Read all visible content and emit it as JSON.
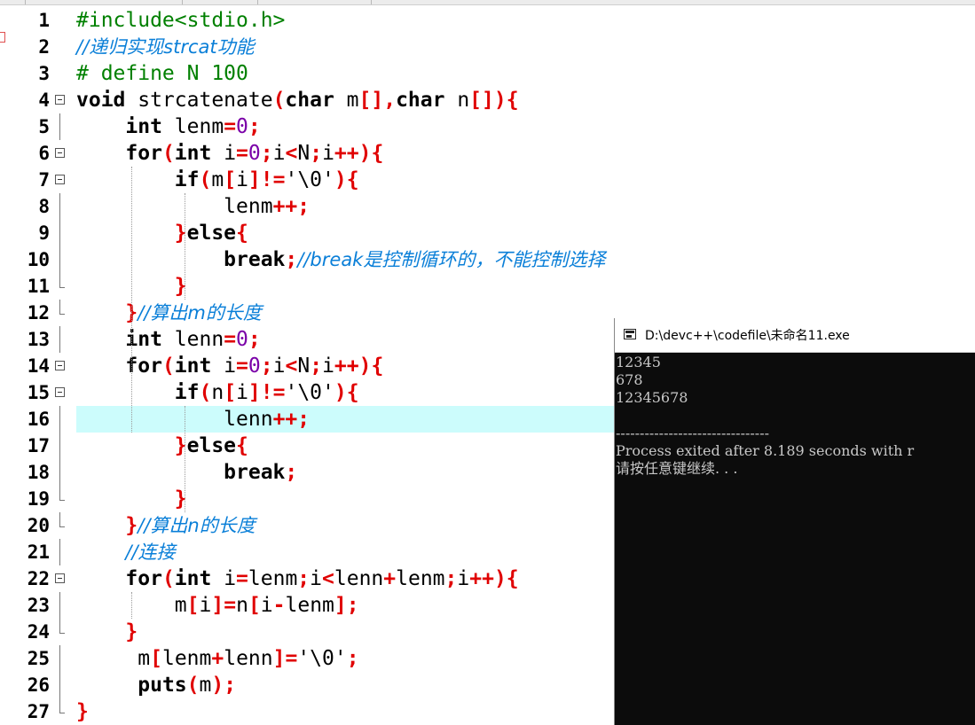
{
  "editor": {
    "line_numbers": [
      "1",
      "2",
      "3",
      "4",
      "5",
      "6",
      "7",
      "8",
      "9",
      "10",
      "11",
      "12",
      "13",
      "14",
      "15",
      "16",
      "17",
      "18",
      "19",
      "20",
      "21",
      "22",
      "23",
      "24",
      "25",
      "26",
      "27"
    ],
    "lines": [
      [
        "#include<stdio.h>"
      ],
      [
        "//递归实现strcat功能"
      ],
      [
        "# define N 100"
      ],
      [
        "void",
        " strcatenate",
        "(",
        "char",
        " m",
        "[]",
        ",",
        "char",
        " n",
        "[]",
        ")",
        "{"
      ],
      [
        "    ",
        "int",
        " lenm",
        "=",
        "0",
        ";"
      ],
      [
        "    ",
        "for",
        "(",
        "int",
        " i",
        "=",
        "0",
        ";",
        "i",
        "<",
        "N",
        ";",
        "i",
        "++",
        ")",
        "{"
      ],
      [
        "        ",
        "if",
        "(",
        "m",
        "[",
        "i",
        "]",
        "!=",
        "'\\0'",
        ")",
        "{"
      ],
      [
        "            ",
        "lenm",
        "++",
        ";"
      ],
      [
        "        ",
        "}",
        "else",
        "{"
      ],
      [
        "            ",
        "break",
        ";",
        "//break是控制循环的，不能控制选择"
      ],
      [
        "        ",
        "}"
      ],
      [
        "    ",
        "}",
        "//算出m的长度"
      ],
      [
        "    ",
        "int",
        " lenn",
        "=",
        "0",
        ";"
      ],
      [
        "    ",
        "for",
        "(",
        "int",
        " i",
        "=",
        "0",
        ";",
        "i",
        "<",
        "N",
        ";",
        "i",
        "++",
        ")",
        "{"
      ],
      [
        "        ",
        "if",
        "(",
        "n",
        "[",
        "i",
        "]",
        "!=",
        "'\\0'",
        ")",
        "{"
      ],
      [
        "            ",
        "lenn",
        "++",
        ";"
      ],
      [
        "        ",
        "}",
        "else",
        "{"
      ],
      [
        "            ",
        "break",
        ";"
      ],
      [
        "        ",
        "}"
      ],
      [
        "    ",
        "}",
        "//算出n的长度"
      ],
      [
        "    ",
        "//连接"
      ],
      [
        "    ",
        "for",
        "(",
        "int",
        " i",
        "=",
        "lenm",
        ";",
        "i",
        "<",
        "lenn",
        "+",
        "lenm",
        ";",
        "i",
        "++",
        ")",
        "{"
      ],
      [
        "        ",
        "m",
        "[",
        "i",
        "]",
        "=",
        "n",
        "[",
        "i",
        "-",
        "lenm",
        "]",
        ";"
      ],
      [
        "    ",
        "}"
      ],
      [
        "     ",
        "m",
        "[",
        "lenm",
        "+",
        "lenn",
        "]",
        "=",
        "'\\0'",
        ";"
      ],
      [
        "     ",
        "puts",
        "(",
        "m",
        ")",
        ";"
      ],
      [
        "}"
      ]
    ],
    "highlighted_line": "16"
  },
  "console": {
    "title": "D:\\devc++\\codefile\\未命名11.exe",
    "output": [
      "12345",
      "678",
      "12345678",
      "",
      "--------------------------------",
      "Process exited after 8.189 seconds with r",
      "请按任意键继续. . ."
    ]
  }
}
